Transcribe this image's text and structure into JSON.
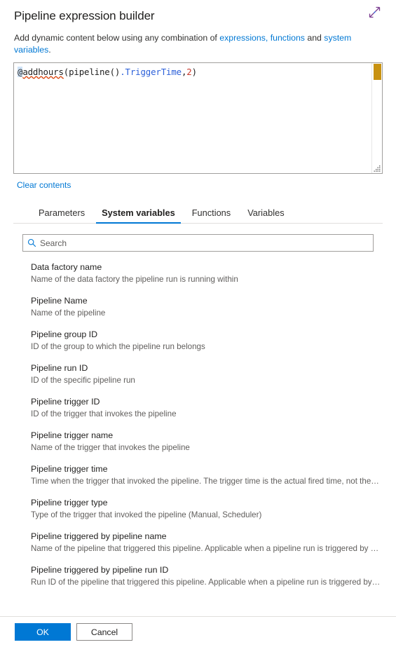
{
  "header": {
    "title": "Pipeline expression builder",
    "expand_icon": "expand-diagonal-icon"
  },
  "subtitle": {
    "prefix": "Add dynamic content below using any combination of ",
    "link1": "expressions, functions",
    "middle": " and ",
    "link2": "system variables",
    "suffix": "."
  },
  "editor": {
    "value": "@addhours(pipeline().TriggerTime,2)",
    "tokens": {
      "at": "@",
      "fn": "addhours",
      "open_paren": "(",
      "ident": "pipeline",
      "empty_parens": "()",
      "prop": ".TriggerTime",
      "comma": ",",
      "num": "2",
      "close_paren": ")"
    },
    "scrollbar_color": "#c89211"
  },
  "clear_contents_label": "Clear contents",
  "tabs": [
    {
      "label": "Parameters",
      "active": false
    },
    {
      "label": "System variables",
      "active": true
    },
    {
      "label": "Functions",
      "active": false
    },
    {
      "label": "Variables",
      "active": false
    }
  ],
  "search": {
    "placeholder": "Search",
    "value": "",
    "icon": "search-icon"
  },
  "system_variables": [
    {
      "name": "Data factory name",
      "description": "Name of the data factory the pipeline run is running within"
    },
    {
      "name": "Pipeline Name",
      "description": "Name of the pipeline"
    },
    {
      "name": "Pipeline group ID",
      "description": "ID of the group to which the pipeline run belongs"
    },
    {
      "name": "Pipeline run ID",
      "description": "ID of the specific pipeline run"
    },
    {
      "name": "Pipeline trigger ID",
      "description": "ID of the trigger that invokes the pipeline"
    },
    {
      "name": "Pipeline trigger name",
      "description": "Name of the trigger that invokes the pipeline"
    },
    {
      "name": "Pipeline trigger time",
      "description": "Time when the trigger that invoked the pipeline. The trigger time is the actual fired time, not the sched…"
    },
    {
      "name": "Pipeline trigger type",
      "description": "Type of the trigger that invoked the pipeline (Manual, Scheduler)"
    },
    {
      "name": "Pipeline triggered by pipeline name",
      "description": "Name of the pipeline that triggered this pipeline. Applicable when a pipeline run is triggered by an Exe…"
    },
    {
      "name": "Pipeline triggered by pipeline run ID",
      "description": "Run ID of the pipeline that triggered this pipeline. Applicable when a pipeline run is triggered by an Ex…"
    }
  ],
  "footer": {
    "ok_label": "OK",
    "cancel_label": "Cancel"
  },
  "colors": {
    "accent": "#0078d4",
    "link": "#0078d4",
    "scrollbar_thumb": "#c89211",
    "error_squiggle": "#d83b01",
    "property_token": "#2b5fd9",
    "number_token": "#c8362a"
  }
}
